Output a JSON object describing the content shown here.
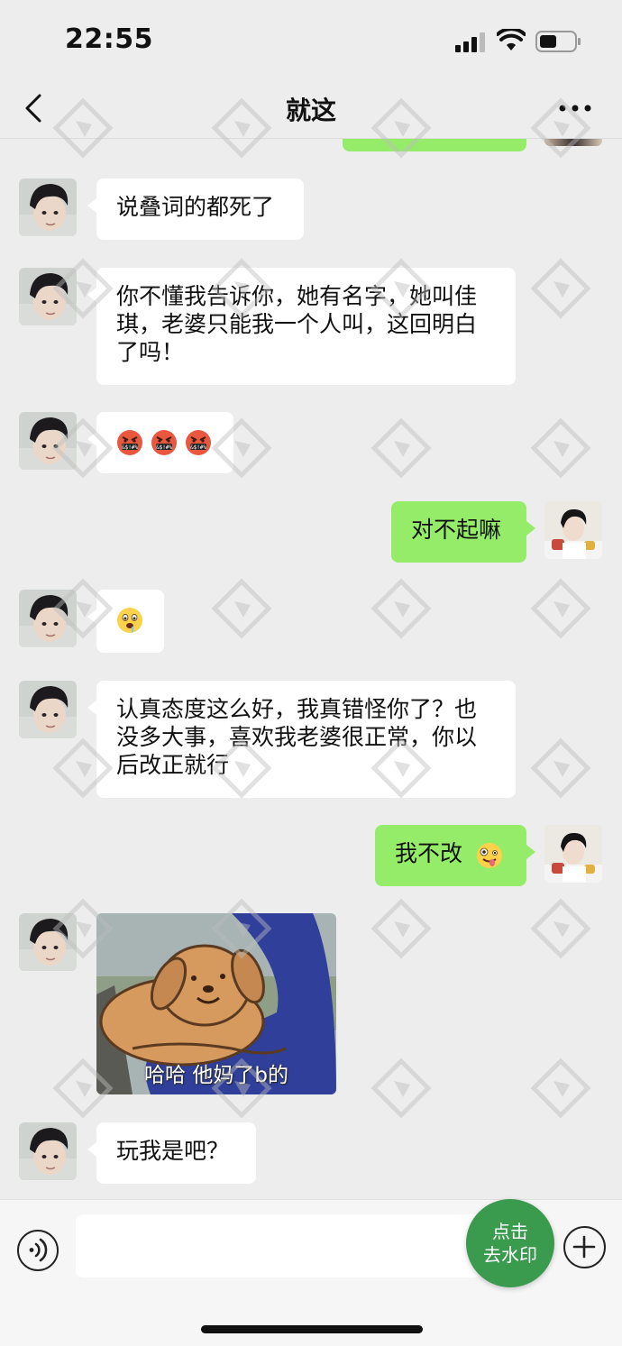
{
  "status_bar": {
    "time": "22:55"
  },
  "nav": {
    "title": "就这"
  },
  "messages": [
    {
      "side": "in",
      "text": "说叠词的都死了"
    },
    {
      "side": "in",
      "text": "你不懂我告诉你，她有名字，她叫佳琪，老婆只能我一个人叫，这回明白了吗！"
    },
    {
      "side": "in",
      "emojis": [
        "cursing-face",
        "cursing-face",
        "cursing-face"
      ]
    },
    {
      "side": "out",
      "text": "对不起嘛"
    },
    {
      "side": "in",
      "emojis": [
        "drooling-face"
      ]
    },
    {
      "side": "in",
      "text": "认真态度这么好，我真错怪你了？也没多大事，喜欢我老婆很正常，你以后改正就行"
    },
    {
      "side": "out",
      "text": "我不改",
      "emoji": "zany-face"
    },
    {
      "side": "in",
      "sticker": {
        "description_icon": "dog-sticker",
        "caption": "哈哈 他妈了b的"
      }
    },
    {
      "side": "in",
      "text": "玩我是吧？"
    }
  ],
  "input_bar": {
    "watermark_button": "点击\n去水印"
  },
  "colors": {
    "outgoing_bubble": "#95ec69",
    "incoming_bubble": "#ffffff",
    "background": "#ededed"
  }
}
